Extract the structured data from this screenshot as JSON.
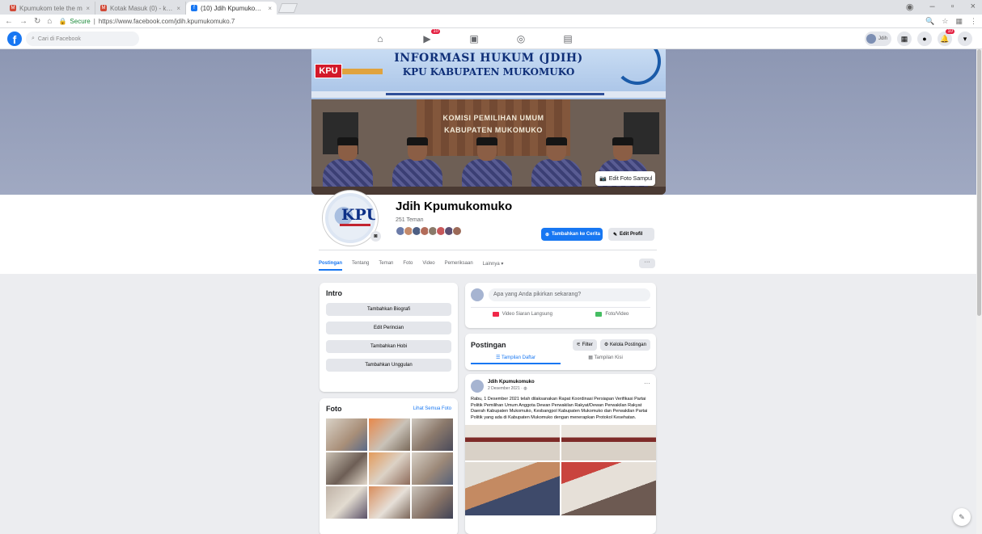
{
  "browser": {
    "tabs": [
      {
        "label": "Kpumukom tele the m",
        "favicon": "gmail-icon",
        "active": false
      },
      {
        "label": "Kotak Masuk (0) - kpum",
        "favicon": "gmail-icon",
        "active": false
      },
      {
        "label": "(10) Jdih Kpumukomuko",
        "favicon": "facebook-icon",
        "active": true
      }
    ],
    "secure_label": "Secure",
    "url": "https://www.facebook.com/jdih.kpumukomuko.7"
  },
  "fb": {
    "search_placeholder": "Cari di Facebook",
    "home_badge": "10",
    "me_label": "Jdih",
    "notif_badge": "10"
  },
  "cover": {
    "title_line1": "INFORMASI HUKUM (JDIH)",
    "title_line2": "KPU KABUPATEN MUKOMUKO",
    "logo_text": "KPU",
    "wall_text_1": "KOMISI PEMILIHAN UMUM",
    "wall_text_2": "KABUPATEN MUKOMUKO",
    "edit_cover_label": "Edit Foto Sampul"
  },
  "profile": {
    "avatar_text": "KPU",
    "name": "Jdih Kpumukomuko",
    "friends": "251 Teman",
    "add_story_label": "Tambahkan ke Cerita",
    "edit_profile_label": "Edit Profil",
    "tabs": [
      "Postingan",
      "Tentang",
      "Teman",
      "Foto",
      "Video",
      "Pemeriksaan",
      "Lainnya ▾"
    ],
    "more_label": "···"
  },
  "intro": {
    "title": "Intro",
    "buttons": [
      "Tambahkan Biografi",
      "Edit Perincian",
      "Tambahkan Hobi",
      "Tambahkan Unggulan"
    ]
  },
  "photos": {
    "title": "Foto",
    "see_all": "Lihat Semua Foto"
  },
  "composer": {
    "placeholder": "Apa yang Anda pikirkan sekarang?",
    "live_label": "Video Siaran Langsung",
    "photo_label": "Foto/Video"
  },
  "posts": {
    "title": "Postingan",
    "filter_label": "Filter",
    "manage_label": "Kelola Postingan",
    "list_view": "Tampilan Daftar",
    "grid_view": "Tampilan Kisi"
  },
  "post": {
    "author": "Jdih Kpumukomuko",
    "date": "2 Desember 2021 ·",
    "text": "Rabu, 1 Desember 2021 telah dilaksanakan Rapat Koordinasi Persiapan Verifikasi Partai Politik Pemilihan Umum Anggota Dewan Perwakilan Rakyat/Dewan Perwakilan Rakyat Daerah Kabupaten Mukomuko, Kesbangpol Kabupaten Mukomuko dan Perwakilan Partai Politik yang ada di Kabupaten Mukomuko dengan menerapkan Protokol Kesehatan."
  },
  "colors": {
    "fb_blue": "#1877f2",
    "badge_red": "#e41e3f",
    "page_bg": "#ecedf0"
  }
}
